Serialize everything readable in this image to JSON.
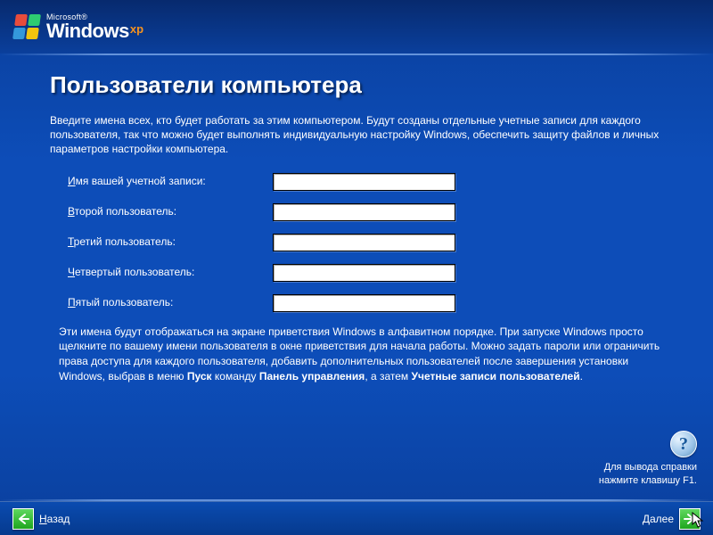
{
  "header": {
    "microsoft": "Microsoft®",
    "windows": "Windows",
    "xp": "xp"
  },
  "title": "Пользователи компьютера",
  "intro": "Введите имена всех, кто будет работать за этим компьютером. Будут созданы отдельные учетные записи для каждого пользователя, так что можно будет выполнять индивидуальную настройку Windows, обеспечить защиту файлов и личных параметров настройки компьютера.",
  "fields": [
    {
      "accel": "И",
      "rest": "мя вашей учетной записи:",
      "value": ""
    },
    {
      "accel": "В",
      "rest": "торой пользователь:",
      "value": ""
    },
    {
      "accel": "Т",
      "rest": "ретий пользователь:",
      "value": ""
    },
    {
      "accel": "Ч",
      "rest": "етвертый пользователь:",
      "value": ""
    },
    {
      "accel": "П",
      "rest": "ятый пользователь:",
      "value": ""
    }
  ],
  "info": {
    "p1": "Эти имена будут отображаться на экране приветствия Windows в алфавитном порядке. При запуске Windows просто щелкните по вашему имени пользователя в окне приветствия для начала работы. Можно задать пароли или ограничить права доступа для каждого пользователя, добавить дополнительных пользователей после завершения установки Windows, выбрав в меню ",
    "b1": "Пуск",
    "p2": " команду ",
    "b2": "Панель управления",
    "p3": ", а затем ",
    "b3": "Учетные записи пользователей",
    "p4": "."
  },
  "help": {
    "symbol": "?",
    "line1": "Для вывода справки",
    "line2": "нажмите клавишу F1."
  },
  "footer": {
    "back_accel": "Н",
    "back_rest": "азад",
    "next_accel": "Д",
    "next_rest": "алее"
  }
}
